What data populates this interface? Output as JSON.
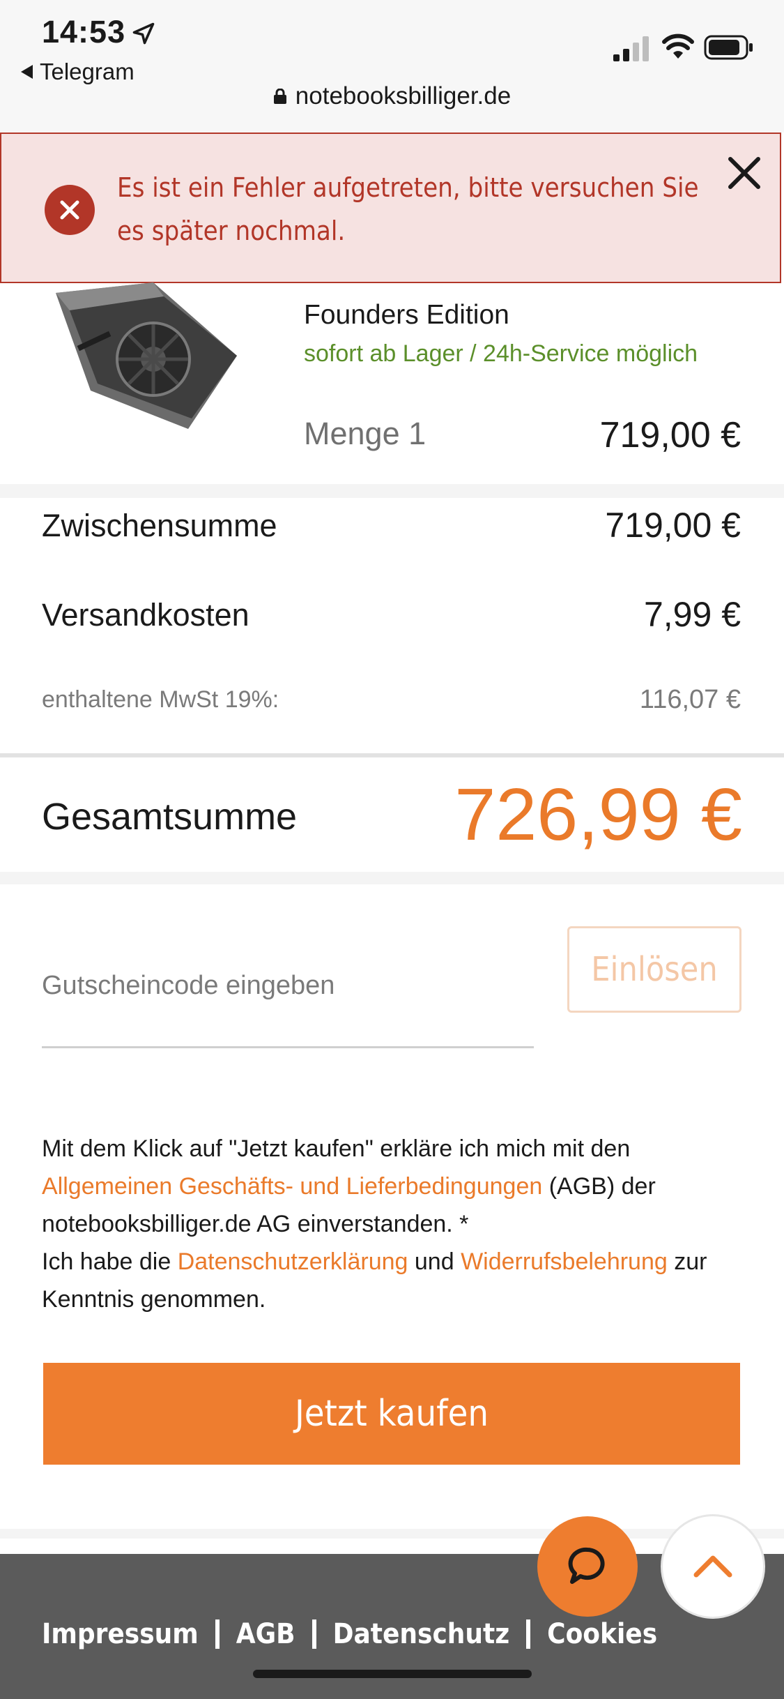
{
  "status_bar": {
    "time": "14:53",
    "back_app": "Telegram",
    "url": "notebooksbilliger.de",
    "icons": [
      "location-arrow-icon",
      "signal-icon",
      "wifi-icon",
      "battery-icon",
      "lock-icon"
    ]
  },
  "error_banner": {
    "message": "Es ist ein Fehler aufgetreten, bitte versuchen Sie es später nochmal.",
    "icon": "error-circle-icon",
    "close_icon": "close-icon",
    "color": "#b23628",
    "background": "#f6e2e1"
  },
  "product": {
    "title": "Founders Edition",
    "availability": "sofort ab Lager / 24h-Service möglich",
    "quantity_label": "Menge 1",
    "price": "719,00 €"
  },
  "summary": {
    "subtotal_label": "Zwischensumme",
    "subtotal_value": "719,00 €",
    "shipping_label": "Versandkosten",
    "shipping_value": "7,99 €",
    "vat_label": "enthaltene MwSt 19%:",
    "vat_value": "116,07 €",
    "total_label": "Gesamtsumme",
    "total_value": "726,99 €"
  },
  "voucher": {
    "placeholder": "Gutscheincode eingeben",
    "redeem_label": "Einlösen"
  },
  "legal": {
    "text1": "Mit dem Klick auf \"Jetzt kaufen\" erkläre ich mich mit den ",
    "agb_link": "Allgemeinen Geschäfts- und Lieferbedingungen",
    "text2": " (AGB) der notebooksbilliger.de AG einverstanden. *",
    "text3": "Ich habe die ",
    "privacy_link": "Datenschutzerklärung",
    "text4": " und ",
    "withdrawal_link": "Widerrufsbelehrung",
    "text5": " zur Kenntnis genommen."
  },
  "buy_button": {
    "label": "Jetzt kaufen"
  },
  "footer": {
    "links": [
      "Impressum",
      "AGB",
      "Datenschutz",
      "Cookies"
    ]
  },
  "floating": {
    "chat_icon": "chat-bubble-icon",
    "top_icon": "chevron-up-icon"
  },
  "colors": {
    "accent": "#ee7d2f",
    "total": "#ea7a2a",
    "stock_green": "#5b8f2a",
    "footer_bg": "#5b5b5b"
  }
}
